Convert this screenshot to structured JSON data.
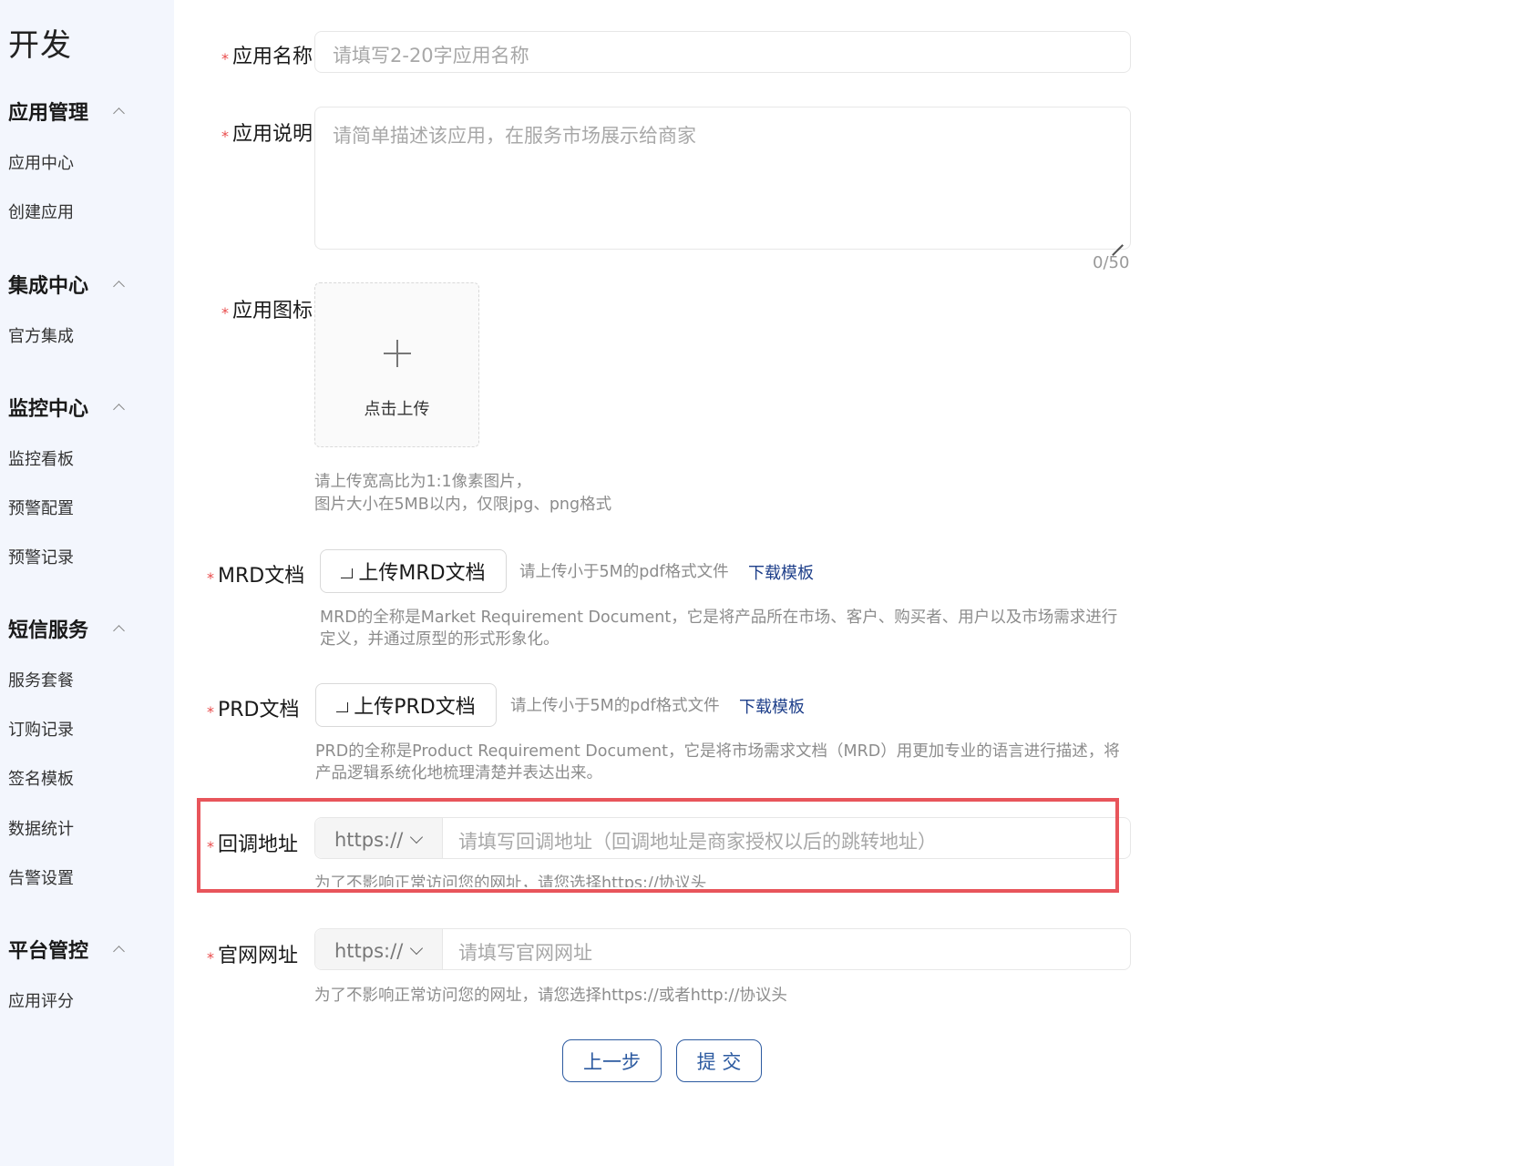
{
  "sidebar": {
    "brand": "开发",
    "groups": [
      {
        "title": "应用管理",
        "items": [
          "应用中心",
          "创建应用"
        ]
      },
      {
        "title": "集成中心",
        "items": [
          "官方集成"
        ]
      },
      {
        "title": "监控中心",
        "items": [
          "监控看板",
          "预警配置",
          "预警记录"
        ]
      },
      {
        "title": "短信服务",
        "items": [
          "服务套餐",
          "订购记录",
          "签名模板",
          "数据统计",
          "告警设置"
        ]
      },
      {
        "title": "平台管控",
        "items": [
          "应用评分"
        ]
      }
    ]
  },
  "form": {
    "required_mark": "*",
    "app_name": {
      "label": "应用名称",
      "placeholder": "请填写2-20字应用名称"
    },
    "app_desc": {
      "label": "应用说明",
      "placeholder": "请简单描述该应用，在服务市场展示给商家",
      "counter": "0/50"
    },
    "app_icon": {
      "label": "应用图标",
      "upload_text": "点击上传",
      "hint_line1": "请上传宽高比为1:1像素图片，",
      "hint_line2": "图片大小在5MB以内，仅限jpg、png格式"
    },
    "mrd": {
      "label": "MRD文档",
      "button": "上传MRD文档",
      "hint": "请上传小于5M的pdf格式文件",
      "link": "下载模板",
      "desc_line1": "MRD的全称是Market Requirement Document，它是将产品所在市场、客户、购买者、用户以及市场需求进行",
      "desc_line2": "定义，并通过原型的形式形象化。"
    },
    "prd": {
      "label": "PRD文档",
      "button": "上传PRD文档",
      "hint": "请上传小于5M的pdf格式文件",
      "link": "下载模板",
      "desc_line1": "PRD的全称是Product Requirement Document，它是将市场需求文档（MRD）用更加专业的语言进行描述，将",
      "desc_line2": "产品逻辑系统化地梳理清楚并表达出来。"
    },
    "callback": {
      "label": "回调地址",
      "protocol": "https://",
      "placeholder": "请填写回调地址（回调地址是商家授权以后的跳转地址）",
      "hint": "为了不影响正常访问您的网址，请您选择https://协议头"
    },
    "website": {
      "label": "官网网址",
      "protocol": "https://",
      "placeholder": "请填写官网网址",
      "hint": "为了不影响正常访问您的网址，请您选择https://或者http://协议头"
    }
  },
  "actions": {
    "prev": "上一步",
    "submit": "提 交"
  },
  "colors": {
    "sidebar_bg": "#f3f6fd",
    "required": "#e94b4b",
    "link": "#1e3f8a",
    "highlight_box": "#e8555b",
    "button_border": "#2c5aa0"
  }
}
